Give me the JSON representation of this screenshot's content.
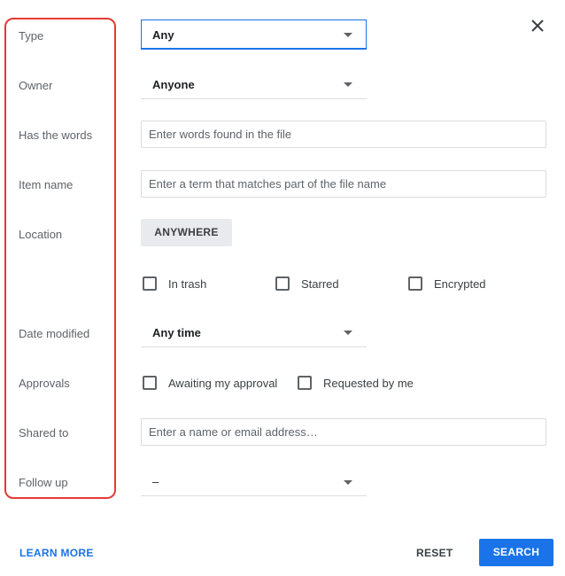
{
  "labels": {
    "type": "Type",
    "owner": "Owner",
    "has_words": "Has the words",
    "item_name": "Item name",
    "location": "Location",
    "date_modified": "Date modified",
    "approvals": "Approvals",
    "shared_to": "Shared to",
    "follow_up": "Follow up"
  },
  "fields": {
    "type_value": "Any",
    "owner_value": "Anyone",
    "has_words_placeholder": "Enter words found in the file",
    "item_name_placeholder": "Enter a term that matches part of the file name",
    "location_button": "ANYWHERE",
    "date_modified_value": "Any time",
    "shared_to_placeholder": "Enter a name or email address…",
    "follow_up_value": "–"
  },
  "checkboxes": {
    "in_trash": "In trash",
    "starred": "Starred",
    "encrypted": "Encrypted",
    "awaiting_approval": "Awaiting my approval",
    "requested_by_me": "Requested by me"
  },
  "footer": {
    "learn_more": "LEARN MORE",
    "reset": "RESET",
    "search": "SEARCH"
  },
  "colors": {
    "accent": "#1a73e8",
    "highlight_border": "#e53935"
  }
}
